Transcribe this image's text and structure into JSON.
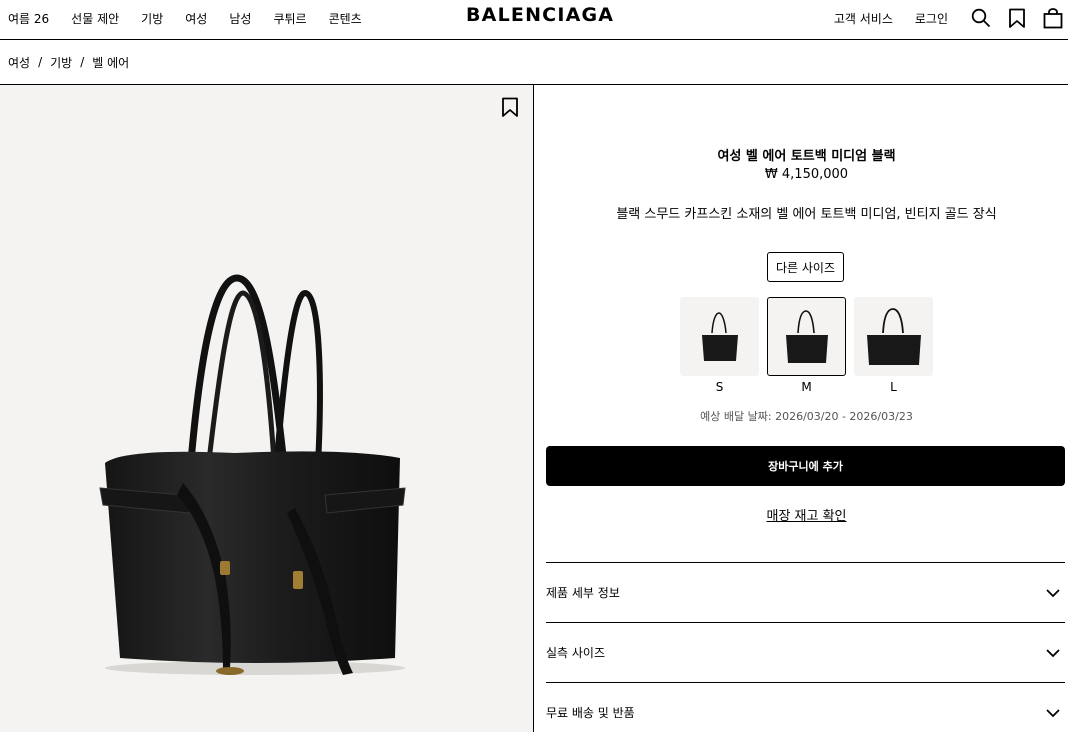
{
  "header": {
    "nav_left": [
      "여름 26",
      "선물 제안",
      "기방",
      "여성",
      "남성",
      "쿠튀르",
      "콘텐츠"
    ],
    "logo": "BALENCIAGA",
    "customer_service": "고객 서비스",
    "login": "로그인"
  },
  "breadcrumb": [
    "여성",
    "기방",
    "벨 에어"
  ],
  "product": {
    "title": "여성 벨 에어 토트백 미디엄 블랙",
    "price": "₩ 4,150,000",
    "description": "블랙 스무드 카프스킨 소재의 벨 에어 토트백 미디엄, 빈티지 골드 장식",
    "other_sizes_label": "다른 사이즈",
    "sizes": [
      {
        "label": "S",
        "selected": false
      },
      {
        "label": "M",
        "selected": true
      },
      {
        "label": "L",
        "selected": false
      }
    ],
    "delivery": "예상 배달 날짜: 2026/03/20 - 2026/03/23",
    "add_to_cart": "장바구니에 추가",
    "store_stock": "매장 재고 확인"
  },
  "accordions": [
    "제품 세부 정보",
    "실측 사이즈",
    "무료 배송 및 반품"
  ],
  "colors": {
    "accent": "#000000",
    "image_bg": "#f4f3f1"
  },
  "icons": [
    "search-icon",
    "bookmark-icon",
    "shopping-bag-icon",
    "chevron-down-icon"
  ]
}
